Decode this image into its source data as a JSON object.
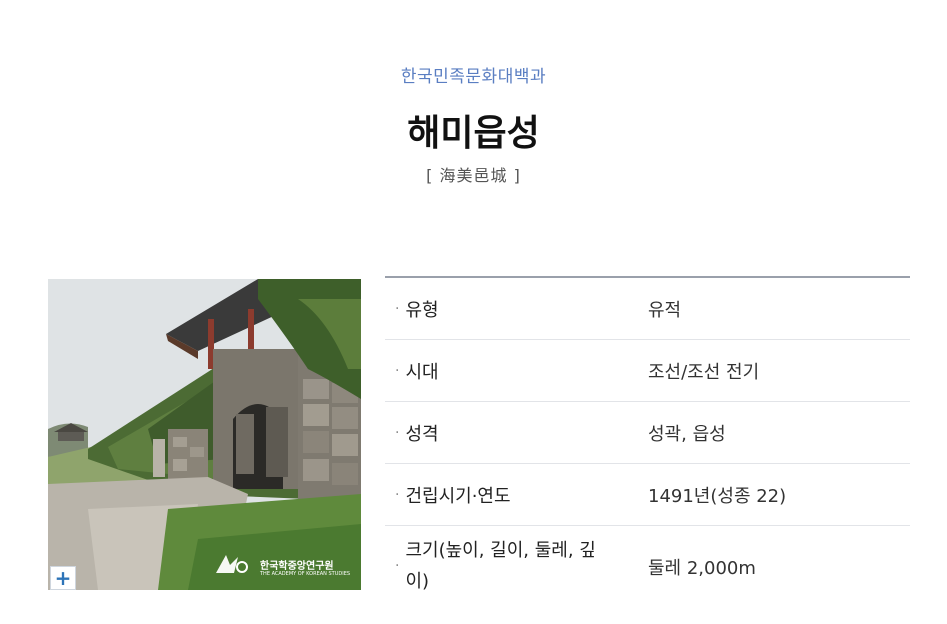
{
  "header": {
    "source": "한국민족문화대백과",
    "title": "해미읍성",
    "hanja": "[ 海美邑城 ]"
  },
  "photo": {
    "zoom_label": "+",
    "watermark_text": "한국학중앙연구원",
    "watermark_sub": "THE ACADEMY OF KOREAN STUDIES"
  },
  "info": {
    "rows": [
      {
        "label": "유형",
        "value": "유적"
      },
      {
        "label": "시대",
        "value": "조선/조선 전기"
      },
      {
        "label": "성격",
        "value": "성곽, 읍성"
      },
      {
        "label": "건립시기·연도",
        "value": "1491년(성종 22)"
      },
      {
        "label": "크기(높이, 길이, 둘레, 깊이)",
        "value": "둘레 2,000m"
      }
    ]
  },
  "colors": {
    "source": "#5a7ec2",
    "divider": "#9aa0ab",
    "zoom": "#2d74b8"
  }
}
